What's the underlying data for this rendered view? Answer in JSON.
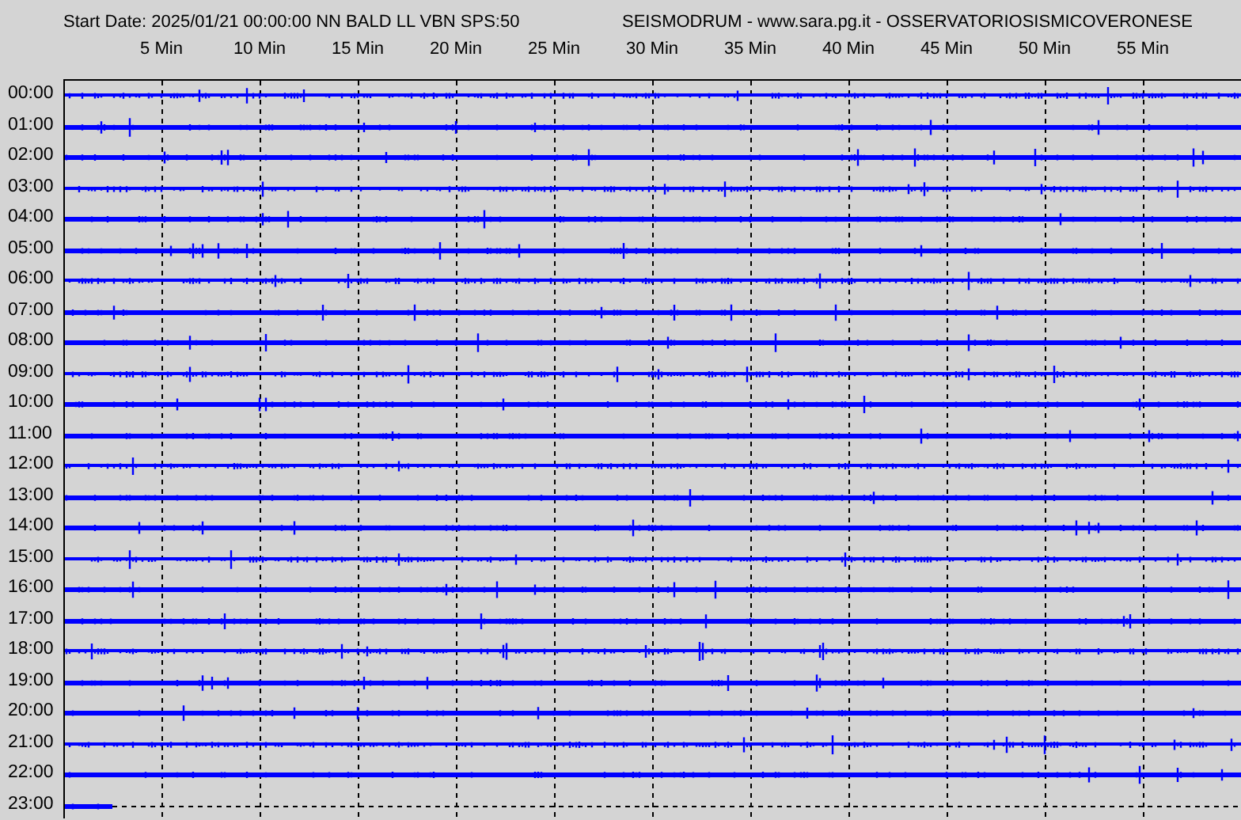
{
  "header": {
    "station_info": "Start Date: 2025/01/21 00:00:00 NN BALD LL VBN SPS:50",
    "source": "SEISMODRUM - www.sara.pg.it - OSSERVATORIOSISMICOVERONESE"
  },
  "time_axis": {
    "labels": [
      "5 Min",
      "10 Min",
      "15 Min",
      "20 Min",
      "25 Min",
      "30 Min",
      "35 Min",
      "40 Min",
      "45 Min",
      "50 Min",
      "55 Min"
    ]
  },
  "rows": [
    {
      "label": "00:00",
      "complete": true
    },
    {
      "label": "01:00",
      "complete": true
    },
    {
      "label": "02:00",
      "complete": true
    },
    {
      "label": "03:00",
      "complete": true
    },
    {
      "label": "04:00",
      "complete": true
    },
    {
      "label": "05:00",
      "complete": true
    },
    {
      "label": "06:00",
      "complete": true
    },
    {
      "label": "07:00",
      "complete": true
    },
    {
      "label": "08:00",
      "complete": true
    },
    {
      "label": "09:00",
      "complete": true
    },
    {
      "label": "10:00",
      "complete": true
    },
    {
      "label": "11:00",
      "complete": true
    },
    {
      "label": "12:00",
      "complete": true
    },
    {
      "label": "13:00",
      "complete": true
    },
    {
      "label": "14:00",
      "complete": true
    },
    {
      "label": "15:00",
      "complete": true
    },
    {
      "label": "16:00",
      "complete": true
    },
    {
      "label": "17:00",
      "complete": true
    },
    {
      "label": "18:00",
      "complete": true
    },
    {
      "label": "19:00",
      "complete": true
    },
    {
      "label": "20:00",
      "complete": true
    },
    {
      "label": "21:00",
      "complete": true
    },
    {
      "label": "22:00",
      "complete": true
    },
    {
      "label": "23:00",
      "complete": false
    }
  ]
}
